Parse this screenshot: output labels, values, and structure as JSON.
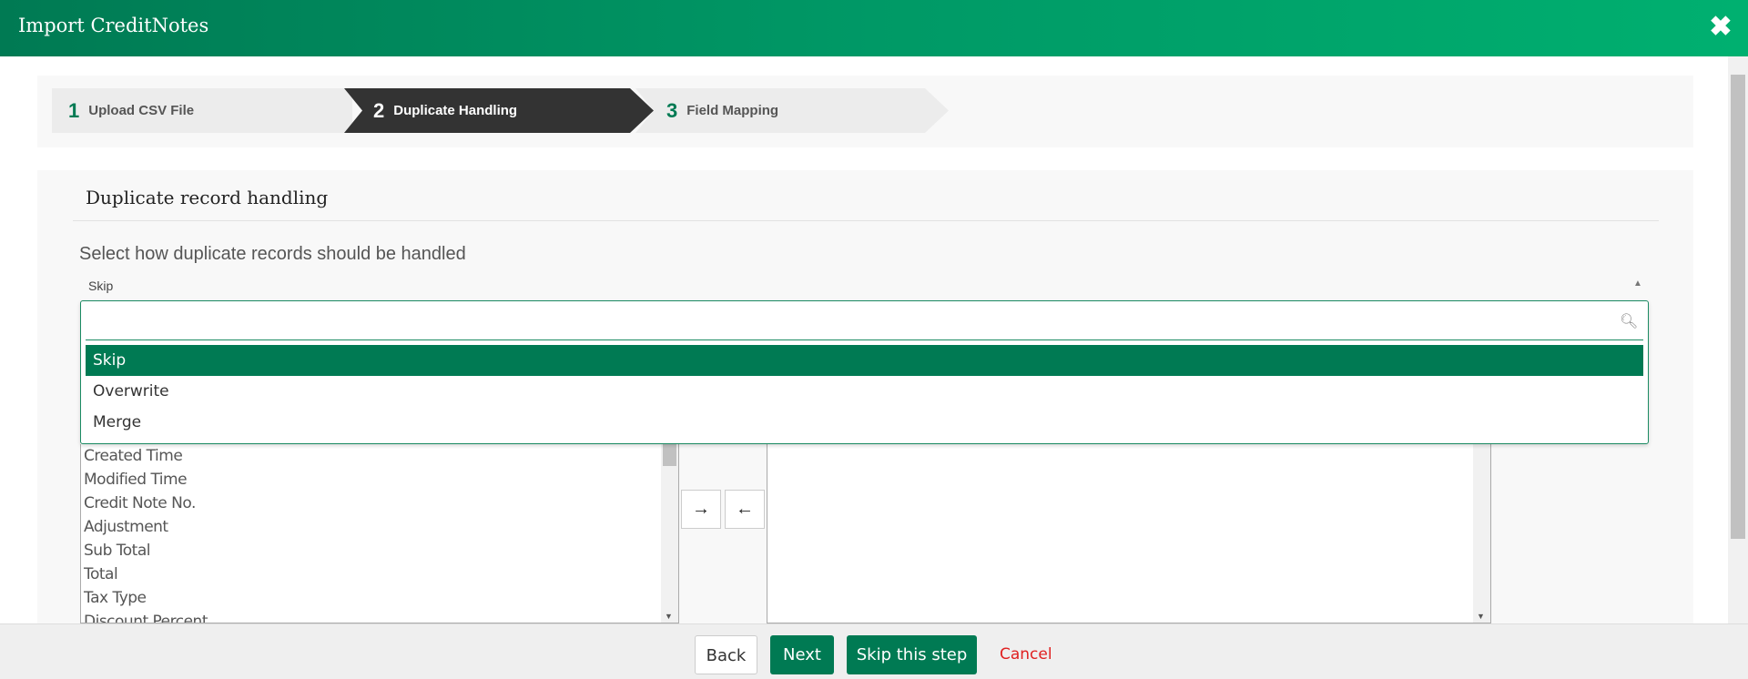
{
  "window": {
    "title": "Import CreditNotes",
    "close_icon": "close-icon"
  },
  "steps": [
    {
      "num": "1",
      "label": "Upload CSV File",
      "state": "done"
    },
    {
      "num": "2",
      "label": "Duplicate Handling",
      "state": "active"
    },
    {
      "num": "3",
      "label": "Field Mapping",
      "state": "pending"
    }
  ],
  "section": {
    "heading": "Duplicate record handling",
    "prompt": "Select how duplicate records should be handled",
    "selected": "Skip"
  },
  "dropdown": {
    "search_value": "",
    "search_placeholder": "",
    "options": [
      "Skip",
      "Overwrite",
      "Merge"
    ],
    "highlighted": "Skip"
  },
  "available_fields": [
    "Created Time",
    "Modified Time",
    "Credit Note No.",
    "Adjustment",
    "Sub Total",
    "Total",
    "Tax Type",
    "Discount Percent"
  ],
  "selected_fields": [],
  "transfer": {
    "add": "→",
    "remove": "←"
  },
  "footer": {
    "back": "Back",
    "next": "Next",
    "skip": "Skip this step",
    "cancel": "Cancel"
  },
  "colors": {
    "brand": "#007a53",
    "cancel": "#e02020",
    "active_step": "#333333"
  }
}
